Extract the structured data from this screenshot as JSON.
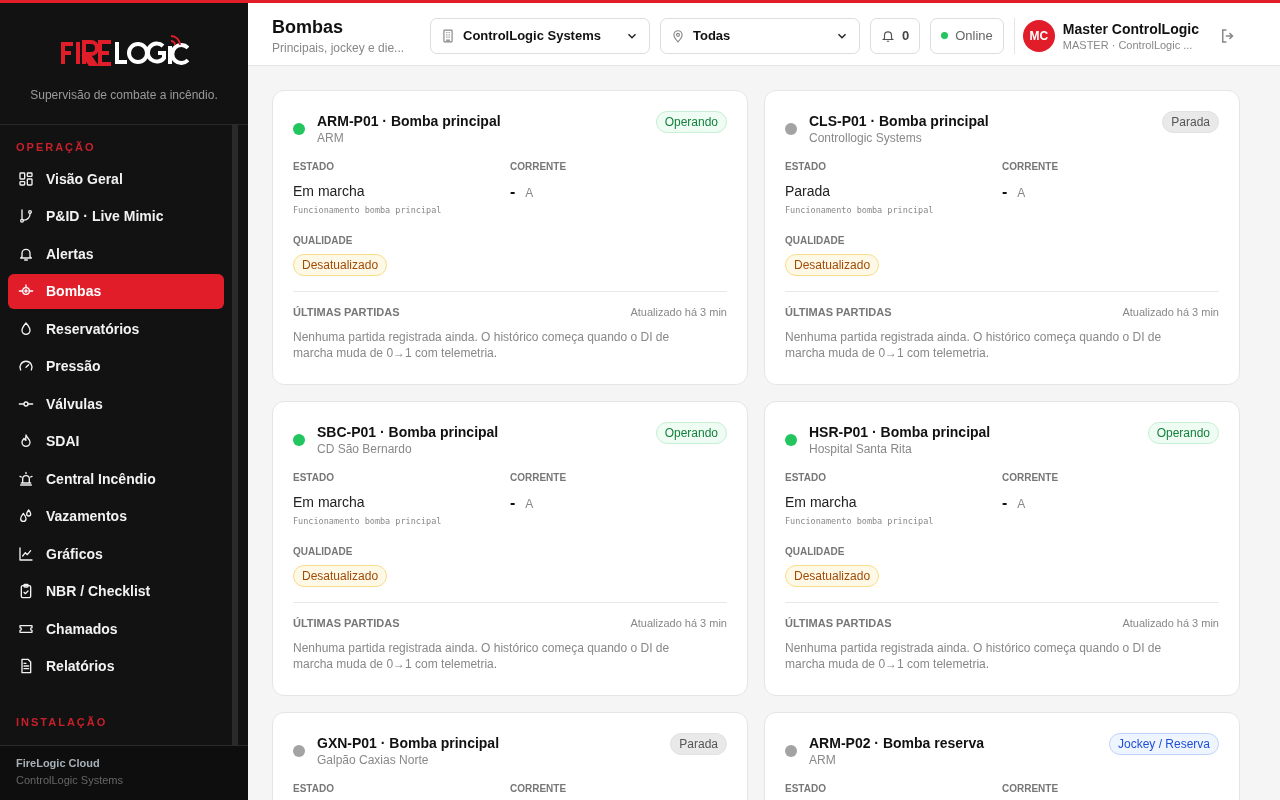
{
  "sidebar": {
    "tagline": "Supervisão de combate a incêndio.",
    "sections": [
      {
        "title": "OPERAÇÃO",
        "items": [
          {
            "label": "Visão Geral",
            "selected": false
          },
          {
            "label": "P&ID · Live Mimic",
            "selected": false
          },
          {
            "label": "Alertas",
            "selected": false
          },
          {
            "label": "Bombas",
            "selected": true
          },
          {
            "label": "Reservatórios",
            "selected": false
          },
          {
            "label": "Pressão",
            "selected": false
          },
          {
            "label": "Válvulas",
            "selected": false
          },
          {
            "label": "SDAI",
            "selected": false
          },
          {
            "label": "Central Incêndio",
            "selected": false
          },
          {
            "label": "Vazamentos",
            "selected": false
          },
          {
            "label": "Gráficos",
            "selected": false
          },
          {
            "label": "NBR / Checklist",
            "selected": false
          },
          {
            "label": "Chamados",
            "selected": false
          },
          {
            "label": "Relatórios",
            "selected": false
          }
        ]
      },
      {
        "title": "INSTALAÇÃO"
      }
    ],
    "footer": {
      "title": "FireLogic Cloud",
      "subtitle": "ControlLogic Systems"
    }
  },
  "header": {
    "title": "Bombas",
    "subtitle": "Principais, jockey e die...",
    "company_select": "ControlLogic Systems",
    "site_select": "Todas",
    "notifications": "0",
    "connection": "Online",
    "user": {
      "initials": "MC",
      "name": "Master ControlLogic",
      "role": "MASTER · ControlLogic ..."
    }
  },
  "cards": [
    {
      "title": "ARM-P01 · Bomba principal",
      "site": "ARM",
      "color": "#22c55e",
      "status": {
        "label": "Operando",
        "kind": "operating"
      },
      "estado_label": "ESTADO",
      "estado": "Em marcha",
      "estado_note": "Funcionamento bomba principal",
      "corrente_label": "CORRENTE",
      "corrente": "-",
      "corrente_unit": "A",
      "qualidade_label": "QUALIDADE",
      "qualidade": "Desatualizado",
      "partidas_label": "ÚLTIMAS PARTIDAS",
      "updated": "Atualizado há 3 min",
      "partidas_text": "Nenhuma partida registrada ainda. O histórico começa quando o DI de marcha muda de 0→1 com telemetria."
    },
    {
      "title": "CLS-P01 · Bomba principal",
      "site": "Controllogic Systems",
      "color": "#a3a3a3",
      "status": {
        "label": "Parada",
        "kind": "stopped"
      },
      "estado_label": "ESTADO",
      "estado": "Parada",
      "estado_note": "Funcionamento bomba principal",
      "corrente_label": "CORRENTE",
      "corrente": "-",
      "corrente_unit": "A",
      "qualidade_label": "QUALIDADE",
      "qualidade": "Desatualizado",
      "partidas_label": "ÚLTIMAS PARTIDAS",
      "updated": "Atualizado há 3 min",
      "partidas_text": "Nenhuma partida registrada ainda. O histórico começa quando o DI de marcha muda de 0→1 com telemetria."
    },
    {
      "title": "SBC-P01 · Bomba principal",
      "site": "CD São Bernardo",
      "color": "#22c55e",
      "status": {
        "label": "Operando",
        "kind": "operating"
      },
      "estado_label": "ESTADO",
      "estado": "Em marcha",
      "estado_note": "Funcionamento bomba principal",
      "corrente_label": "CORRENTE",
      "corrente": "-",
      "corrente_unit": "A",
      "qualidade_label": "QUALIDADE",
      "qualidade": "Desatualizado",
      "partidas_label": "ÚLTIMAS PARTIDAS",
      "updated": "Atualizado há 3 min",
      "partidas_text": "Nenhuma partida registrada ainda. O histórico começa quando o DI de marcha muda de 0→1 com telemetria."
    },
    {
      "title": "HSR-P01 · Bomba principal",
      "site": "Hospital Santa Rita",
      "color": "#22c55e",
      "status": {
        "label": "Operando",
        "kind": "operating"
      },
      "estado_label": "ESTADO",
      "estado": "Em marcha",
      "estado_note": "Funcionamento bomba principal",
      "corrente_label": "CORRENTE",
      "corrente": "-",
      "corrente_unit": "A",
      "qualidade_label": "QUALIDADE",
      "qualidade": "Desatualizado",
      "partidas_label": "ÚLTIMAS PARTIDAS",
      "updated": "Atualizado há 3 min",
      "partidas_text": "Nenhuma partida registrada ainda. O histórico começa quando o DI de marcha muda de 0→1 com telemetria."
    },
    {
      "title": "GXN-P01 · Bomba principal",
      "site": "Galpão Caxias Norte",
      "color": "#a3a3a3",
      "status": {
        "label": "Parada",
        "kind": "stopped"
      },
      "estado_label": "ESTADO",
      "corrente_label": "CORRENTE"
    },
    {
      "title": "ARM-P02 · Bomba reserva",
      "site": "ARM",
      "color": "#a3a3a3",
      "status": {
        "label": "Jockey / Reserva",
        "kind": "jockey"
      },
      "estado_label": "ESTADO",
      "corrente_label": "CORRENTE"
    }
  ]
}
